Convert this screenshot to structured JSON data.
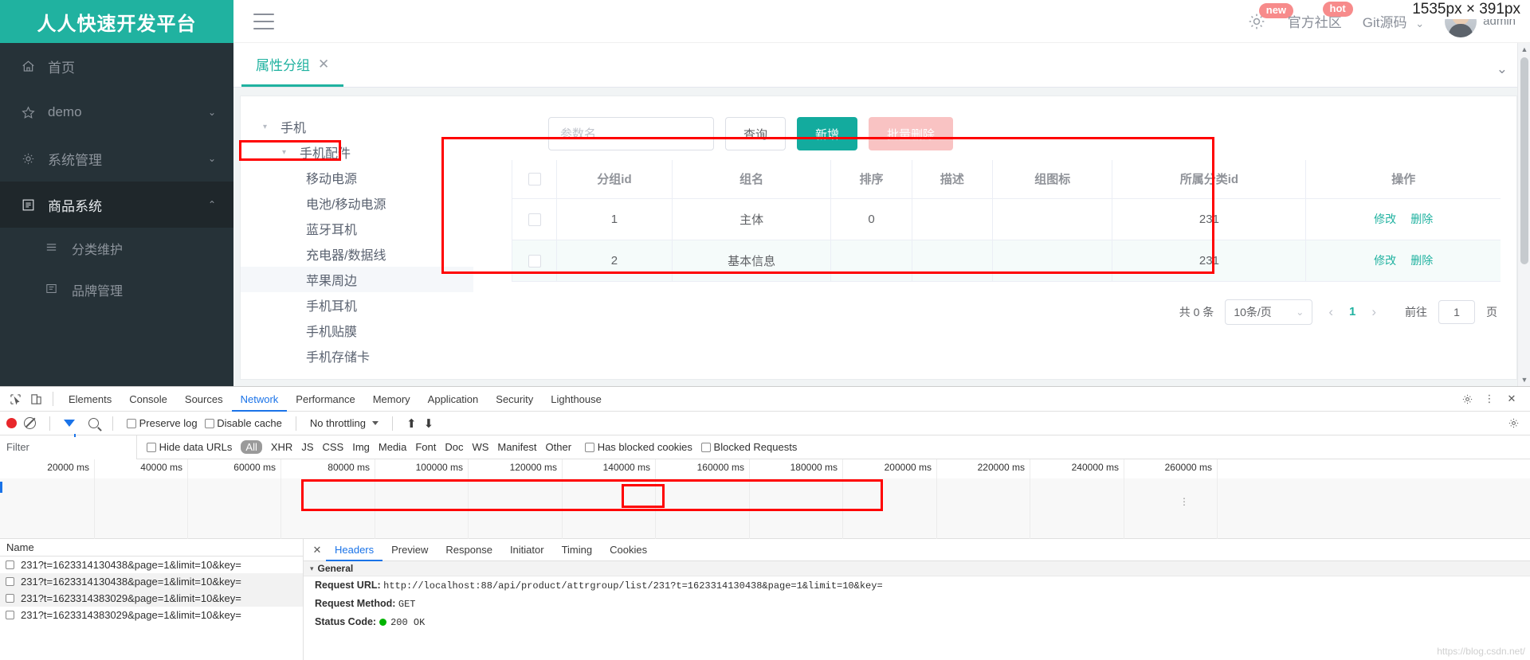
{
  "app": {
    "logo_text": "人人快速开发平台",
    "hamburger_icon": "hamburger-icon",
    "header": {
      "gear_icon": "gear-icon",
      "new_badge": "new",
      "hot_badge": "hot",
      "community_link": "官方社区",
      "git_link": "Git源码",
      "caret": "⌄",
      "user_name": "admin"
    },
    "measure_tooltip": "1535px × 391px",
    "sidebar": {
      "items": [
        {
          "label": "首页",
          "icon": "home-icon",
          "caret": "",
          "active": false
        },
        {
          "label": "demo",
          "icon": "star-icon",
          "caret": "⌄",
          "active": false
        },
        {
          "label": "系统管理",
          "icon": "gear-icon",
          "caret": "⌄",
          "active": false
        },
        {
          "label": "商品系统",
          "icon": "product-icon",
          "caret": "⌃",
          "active": true
        }
      ],
      "subitems": [
        {
          "label": "分类维护",
          "icon": "list-icon"
        },
        {
          "label": "品牌管理",
          "icon": "brand-icon"
        }
      ]
    },
    "tabbar": {
      "tabs": [
        {
          "label": "属性分组",
          "close": "✕",
          "active": true
        }
      ],
      "collapse_caret": "⌄"
    },
    "tree": {
      "nodes": [
        {
          "label": "手机",
          "indent": 0,
          "arrow": "▾",
          "highlight": false,
          "hover": false
        },
        {
          "label": "手机配件",
          "indent": 1,
          "arrow": "▾",
          "highlight": false,
          "hover": false
        },
        {
          "label": "移动电源",
          "indent": 2,
          "arrow": "",
          "highlight": true,
          "hover": false
        },
        {
          "label": "电池/移动电源",
          "indent": 2,
          "arrow": "",
          "highlight": false,
          "hover": false
        },
        {
          "label": "蓝牙耳机",
          "indent": 2,
          "arrow": "",
          "highlight": false,
          "hover": false
        },
        {
          "label": "充电器/数据线",
          "indent": 2,
          "arrow": "",
          "highlight": false,
          "hover": false
        },
        {
          "label": "苹果周边",
          "indent": 2,
          "arrow": "",
          "highlight": false,
          "hover": true
        },
        {
          "label": "手机耳机",
          "indent": 2,
          "arrow": "",
          "highlight": false,
          "hover": false
        },
        {
          "label": "手机贴膜",
          "indent": 2,
          "arrow": "",
          "highlight": false,
          "hover": false
        },
        {
          "label": "手机存储卡",
          "indent": 2,
          "arrow": "",
          "highlight": false,
          "hover": false
        }
      ]
    },
    "toolbar": {
      "search_value": "",
      "search_placeholder": "参数名",
      "query_label": "查询",
      "add_label": "新增",
      "batch_delete_label": "批量删除"
    },
    "table": {
      "headers": [
        "",
        "分组id",
        "组名",
        "排序",
        "描述",
        "组图标",
        "所属分类id",
        "操作"
      ],
      "rows": [
        {
          "id": "1",
          "name": "主体",
          "sort": "0",
          "desc": "",
          "icon": "",
          "catid": "231",
          "edit": "修改",
          "delete": "删除"
        },
        {
          "id": "2",
          "name": "基本信息",
          "sort": "",
          "desc": "",
          "icon": "",
          "catid": "231",
          "edit": "修改",
          "delete": "删除"
        }
      ]
    },
    "pager": {
      "total_text": "共 0 条",
      "page_size": "10条/页",
      "page_size_caret": "⌄",
      "prev": "‹",
      "current_page": "1",
      "next": "›",
      "goto_label": "前往",
      "goto_value": "1",
      "page_unit": "页"
    }
  },
  "devtools": {
    "inspect_icon": "inspect-element-icon",
    "device_icon": "device-toolbar-icon",
    "tabs": [
      {
        "label": "Elements",
        "active": false
      },
      {
        "label": "Console",
        "active": false
      },
      {
        "label": "Sources",
        "active": false
      },
      {
        "label": "Network",
        "active": true
      },
      {
        "label": "Performance",
        "active": false
      },
      {
        "label": "Memory",
        "active": false
      },
      {
        "label": "Application",
        "active": false
      },
      {
        "label": "Security",
        "active": false
      },
      {
        "label": "Lighthouse",
        "active": false
      }
    ],
    "settings_icon": "gear-icon",
    "more_icon": "more-vertical-icon",
    "close_icon": "close-icon",
    "toolbar2": {
      "record_icon": "record-icon",
      "clear_icon": "clear-icon",
      "filter_icon": "filter-icon",
      "search_icon": "search-icon",
      "preserve_log": "Preserve log",
      "disable_cache": "Disable cache",
      "throttling": "No throttling",
      "import_icon": "import-har-icon",
      "export_icon": "export-har-icon",
      "settings_icon": "network-settings-icon"
    },
    "filterbar": {
      "filter_value": "",
      "filter_placeholder": "Filter",
      "hide_data_urls": "Hide data URLs",
      "types": [
        "All",
        "XHR",
        "JS",
        "CSS",
        "Img",
        "Media",
        "Font",
        "Doc",
        "WS",
        "Manifest",
        "Other"
      ],
      "selected_type": "All",
      "has_blocked_cookies": "Has blocked cookies",
      "blocked_requests": "Blocked Requests"
    },
    "timeline": {
      "ticks": [
        "20000 ms",
        "40000 ms",
        "60000 ms",
        "80000 ms",
        "100000 ms",
        "120000 ms",
        "140000 ms",
        "160000 ms",
        "180000 ms",
        "200000 ms",
        "220000 ms",
        "240000 ms",
        "260000 ms"
      ]
    },
    "requests": {
      "column_header": "Name",
      "rows": [
        "231?t=1623314130438&page=1&limit=10&key=",
        "231?t=1623314130438&page=1&limit=10&key=",
        "231?t=1623314383029&page=1&limit=10&key=",
        "231?t=1623314383029&page=1&limit=10&key="
      ]
    },
    "detail": {
      "close_icon": "✕",
      "tabs": [
        {
          "label": "Headers",
          "active": true
        },
        {
          "label": "Preview",
          "active": false
        },
        {
          "label": "Response",
          "active": false
        },
        {
          "label": "Initiator",
          "active": false
        },
        {
          "label": "Timing",
          "active": false
        },
        {
          "label": "Cookies",
          "active": false
        }
      ],
      "section_title": "General",
      "section_caret": "▾",
      "request_url_key": "Request URL:",
      "request_url_value": "http://localhost:88/api/product/attrgroup/list/231?t=1623314130438&page=1&limit=10&key=",
      "request_method_key": "Request Method:",
      "request_method_value": "GET",
      "status_code_key": "Status Code:",
      "status_code_value": "200 OK"
    }
  },
  "watermark": "https://blog.csdn.net/",
  "colors": {
    "brand": "#20b2a0",
    "sidebar_bg": "#263238",
    "annotation": "#ff0000",
    "devtools_accent": "#1a73e8"
  }
}
